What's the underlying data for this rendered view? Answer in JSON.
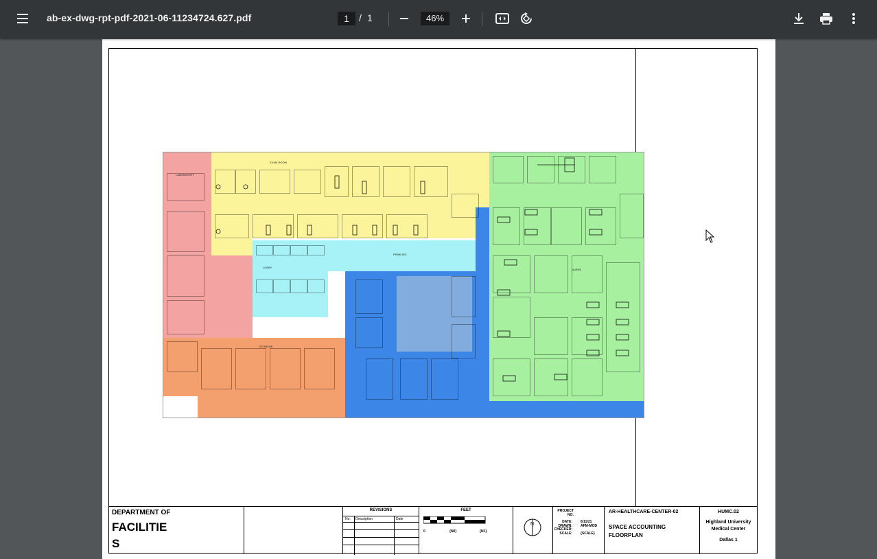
{
  "toolbar": {
    "menu_icon": "hamburger-menu-icon",
    "file_name": "ab-ex-dwg-rpt-pdf-2021-06-11234724.627.pdf",
    "page_current": "1",
    "page_separator": "/",
    "page_total": "1",
    "zoom_out_icon": "minus-icon",
    "zoom_level": "46%",
    "zoom_in_icon": "plus-icon",
    "fit_icon": "fit-page-icon",
    "rotate_icon": "rotate-icon",
    "download_icon": "download-icon",
    "print_icon": "print-icon",
    "more_icon": "more-vertical-icon"
  },
  "titleblock": {
    "dept_of": "DEPARTMENT OF",
    "facilities_line1": "FACILITIE",
    "facilities_line2": "S",
    "revisions_header": "REVISIONS",
    "rev_col_no": "No.",
    "rev_col_desc": "Description",
    "rev_col_date": "Date",
    "feet_header": "FEET",
    "scale_zero": "0",
    "scale_n0": "{N0}",
    "scale_n1": "{N1}",
    "north_label": "N",
    "project_no_label": "PROJECT\nNO:",
    "date_label": "DATE:",
    "date_value": "6/11/21",
    "drawn_label": "DRAWN:",
    "drawn_value": "AFM-MOD",
    "checked_label": "CHECKED:",
    "scale_label": "SCALE:",
    "scale_value": "{SCALE}",
    "drawing_id": "AR-HEALTHCARE-CENTER-02",
    "drawing_title_1": "SPACE ACCOUNTING",
    "drawing_title_2": "FLOORPLAN",
    "building_code": "HUMC.02",
    "org_name_1": "Highland University",
    "org_name_2": "Medical Center",
    "site_name": "Dallas 1"
  },
  "colors": {
    "toolbar_bg": "#323639",
    "viewer_bg": "#525659",
    "zone_pink": "#f4a3a3",
    "zone_yellow": "#fbf49a",
    "zone_green": "#a6f0a0",
    "zone_cyan": "#a6f2f6",
    "zone_blue": "#3b86e6",
    "zone_orange": "#f4a06e"
  }
}
